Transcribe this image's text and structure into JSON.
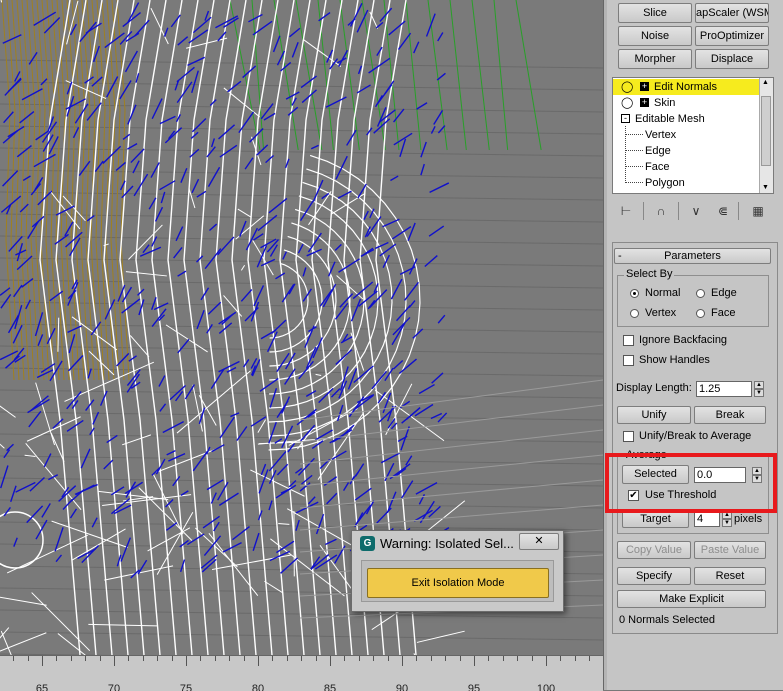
{
  "toolbar_buttons": {
    "slice": "Slice",
    "uvw_scaler": "apScaler (WSM",
    "noise": "Noise",
    "prooptimizer": "ProOptimizer",
    "morpher": "Morpher",
    "displace": "Displace"
  },
  "modifier_stack": {
    "items": [
      "Edit Normals",
      "Skin",
      "Editable Mesh",
      "Vertex",
      "Edge",
      "Face",
      "Polygon"
    ],
    "selected": "Edit Normals"
  },
  "parameters": {
    "rollout_toggle": "-",
    "title": "Parameters",
    "select_by": {
      "label": "Select By",
      "normal": "Normal",
      "edge": "Edge",
      "vertex": "Vertex",
      "face": "Face",
      "selected_option": "Normal"
    },
    "ignore_backfacing": {
      "label": "Ignore Backfacing",
      "checked": false
    },
    "show_handles": {
      "label": "Show Handles",
      "checked": false
    },
    "display_length": {
      "label": "Display Length:",
      "value": "1.25"
    },
    "unify": "Unify",
    "break": "Break",
    "unify_break_to_average": {
      "label": "Unify/Break to Average",
      "checked": false
    },
    "average": {
      "label": "Average",
      "selected_button": "Selected",
      "threshold_value": "0.0",
      "use_threshold": {
        "label": "Use Threshold",
        "checked": true,
        "mark": "✔"
      },
      "target_button": "Target",
      "target_value": "4",
      "pixels_label": "pixels"
    },
    "copy_value": "Copy Value",
    "paste_value": "Paste Value",
    "specify": "Specify",
    "reset": "Reset",
    "make_explicit": "Make Explicit",
    "status": "0 Normals Selected"
  },
  "dialog": {
    "title": "Warning: Isolated Sel...",
    "close": "✕",
    "app_icon": "G",
    "button": "Exit Isolation Mode"
  },
  "timeline": {
    "labels": [
      "65",
      "70",
      "75",
      "80",
      "85",
      "90",
      "95",
      "100"
    ]
  },
  "colors": {
    "highlight": "#e8191c",
    "stack_selection": "#f6eb1e",
    "dialog_button": "#f0c94a",
    "normals": "#1010cc",
    "wireframe": "#ffffff",
    "mesh_gold": "#a08020",
    "mesh_green": "#28a028"
  }
}
